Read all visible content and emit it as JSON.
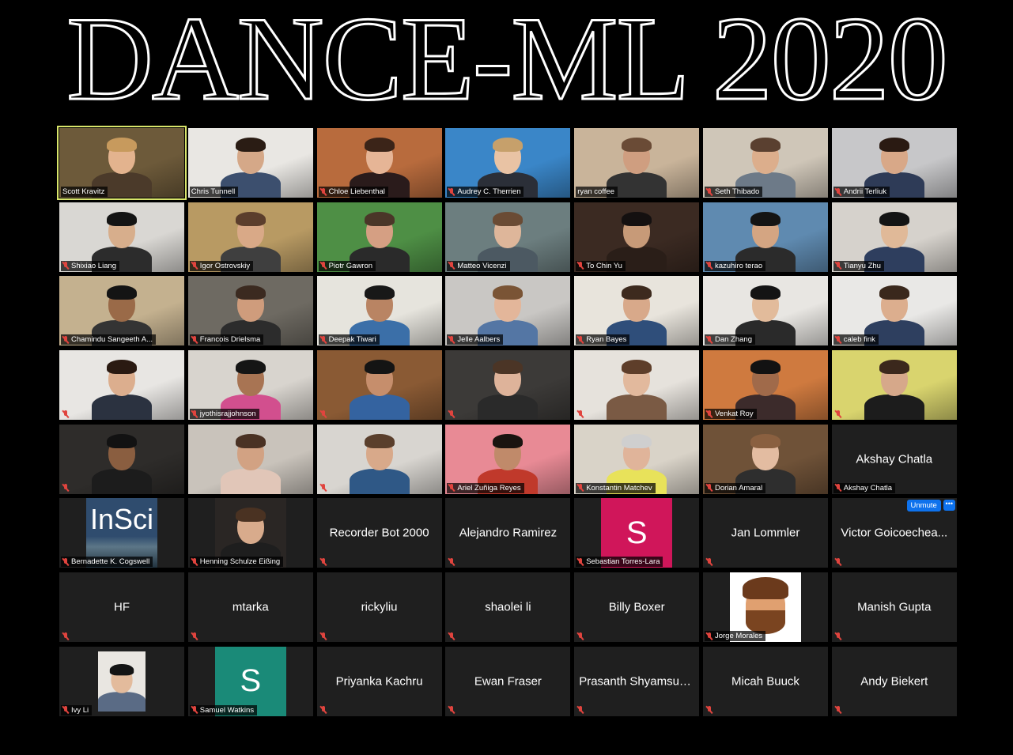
{
  "title": "DANCE-ML 2020",
  "controls": {
    "unmute_label": "Unmute",
    "more_label": "•••"
  },
  "tiles": [
    {
      "name": "Scott Kravitz",
      "type": "video",
      "bg": "#6d5a3a",
      "skin": "#e3b38e",
      "shirt": "#4b3a2a",
      "hair": "#c79a5d",
      "active": true,
      "muted": false
    },
    {
      "name": "Chris Tunnell",
      "type": "video",
      "bg": "#e9e7e3",
      "skin": "#d5a888",
      "shirt": "#3c4f6e",
      "hair": "#2a1c14",
      "muted": false
    },
    {
      "name": "Chloe Liebenthal",
      "type": "video",
      "bg": "#b86b3d",
      "skin": "#e6b596",
      "shirt": "#2a1b1b",
      "hair": "#3b2418",
      "muted": true
    },
    {
      "name": "Audrey C. Therrien",
      "type": "video",
      "bg": "#3a86c8",
      "skin": "#e9c3a4",
      "shirt": "#2b2f38",
      "hair": "#c6a06b",
      "muted": true
    },
    {
      "name": "ryan coffee",
      "type": "video",
      "bg": "#c9b49a",
      "skin": "#cf9e80",
      "shirt": "#333333",
      "hair": "#6a4b36",
      "muted": false
    },
    {
      "name": "Seth Thibado",
      "type": "video",
      "bg": "#cfc6b8",
      "skin": "#dcae8c",
      "shirt": "#6d7a88",
      "hair": "#5a4030",
      "muted": true
    },
    {
      "name": "Andrii Terliuk",
      "type": "video",
      "bg": "#c7c7c9",
      "skin": "#d8a888",
      "shirt": "#2e3b57",
      "hair": "#2a1a12",
      "muted": true
    },
    {
      "name": "Shixiao Liang",
      "type": "video",
      "bg": "#d9d7d3",
      "skin": "#d7ae8c",
      "shirt": "#2c2c2c",
      "hair": "#141414",
      "muted": true
    },
    {
      "name": "Igor Ostrovskiy",
      "type": "video",
      "bg": "#b89a63",
      "skin": "#d9a987",
      "shirt": "#3f3f3f",
      "hair": "#5b3e2c",
      "muted": true
    },
    {
      "name": "Piotr Gawron",
      "type": "video",
      "bg": "#4e8f45",
      "skin": "#d59f83",
      "shirt": "#2a2a2a",
      "hair": "#4a3628",
      "muted": true
    },
    {
      "name": "Matteo Vicenzi",
      "type": "video",
      "bg": "#6c7e7f",
      "skin": "#deb69a",
      "shirt": "#4c5962",
      "hair": "#6a4b34",
      "muted": true
    },
    {
      "name": "To Chin Yu",
      "type": "video",
      "bg": "#3b2a22",
      "skin": "#c79a78",
      "shirt": "#2a1e18",
      "hair": "#141010",
      "muted": true
    },
    {
      "name": "kazuhiro terao",
      "type": "video",
      "bg": "#5f8ab0",
      "skin": "#d4a582",
      "shirt": "#2b2b2b",
      "hair": "#141414",
      "muted": true
    },
    {
      "name": "Tianyu Zhu",
      "type": "video",
      "bg": "#d6d2cc",
      "skin": "#e0b998",
      "shirt": "#2e3e5e",
      "hair": "#141414",
      "muted": true
    },
    {
      "name": "Chamindu Sangeeth A...",
      "type": "video",
      "bg": "#c4b18f",
      "skin": "#9a6a48",
      "shirt": "#343434",
      "hair": "#141414",
      "muted": true
    },
    {
      "name": "Francois Drielsma",
      "type": "video",
      "bg": "#6e6a62",
      "skin": "#cf9c7c",
      "shirt": "#2c2c2c",
      "hair": "#3b2a20",
      "muted": true
    },
    {
      "name": "Deepak Tiwari",
      "type": "video",
      "bg": "#e6e4dd",
      "skin": "#b98463",
      "shirt": "#3b6fa8",
      "hair": "#181818",
      "muted": true
    },
    {
      "name": "Jelle Aalbers",
      "type": "video",
      "bg": "#c9c7c4",
      "skin": "#e3b69a",
      "shirt": "#5476a4",
      "hair": "#7a5435",
      "muted": true
    },
    {
      "name": "Ryan Bayes",
      "type": "video",
      "bg": "#e8e4dc",
      "skin": "#d8a98a",
      "shirt": "#2f4e7a",
      "hair": "#3d2a1e",
      "muted": true
    },
    {
      "name": "Dan Zhang",
      "type": "video",
      "bg": "#e8e6e2",
      "skin": "#e2bb9b",
      "shirt": "#2a2a2a",
      "hair": "#141414",
      "muted": true
    },
    {
      "name": "caleb fink",
      "type": "video",
      "bg": "#e9e8e6",
      "skin": "#dcae8e",
      "shirt": "#2e3f5f",
      "hair": "#3a281c",
      "muted": true
    },
    {
      "name": "",
      "type": "video",
      "bg": "#e8e6e3",
      "skin": "#dcae8e",
      "shirt": "#2b3240",
      "hair": "#2a1a12",
      "muted": true
    },
    {
      "name": "jyothisrajjohnson",
      "type": "video",
      "bg": "#d8d4ce",
      "skin": "#a87453",
      "shirt": "#d24f8e",
      "hair": "#151515",
      "muted": true
    },
    {
      "name": "",
      "type": "video",
      "bg": "#8a5a34",
      "skin": "#c68e6c",
      "shirt": "#3463a0",
      "hair": "#141414",
      "muted": true
    },
    {
      "name": "",
      "type": "video",
      "bg": "#3c3a38",
      "skin": "#deb39a",
      "shirt": "#2a2a2a",
      "hair": "#4b3526",
      "muted": true
    },
    {
      "name": "",
      "type": "video",
      "bg": "#e6e2dc",
      "skin": "#e2b99d",
      "shirt": "#7a5a44",
      "hair": "#5e3e2a",
      "muted": true
    },
    {
      "name": "Venkat Roy",
      "type": "video",
      "bg": "#cf7a3f",
      "skin": "#a06a4a",
      "shirt": "#3c2b2b",
      "hair": "#121212",
      "muted": true
    },
    {
      "name": "",
      "type": "video",
      "bg": "#d9d46e",
      "skin": "#d6a88a",
      "shirt": "#1c1c1c",
      "hair": "#3b281c",
      "muted": true
    },
    {
      "name": "",
      "type": "video",
      "bg": "#2e2c2a",
      "skin": "#8a5e40",
      "shirt": "#1c1c1c",
      "hair": "#121212",
      "muted": true
    },
    {
      "name": "",
      "type": "video",
      "bg": "#c9c3bb",
      "skin": "#d2a283",
      "shirt": "#e1c6b8",
      "hair": "#4a3224",
      "muted": false
    },
    {
      "name": "",
      "type": "video",
      "bg": "#d8d5d0",
      "skin": "#d8a98a",
      "shirt": "#2f5886",
      "hair": "#5a3f2c",
      "muted": true
    },
    {
      "name": "Ariel Zuñiga Reyes",
      "type": "video",
      "bg": "#e88a95",
      "skin": "#c08a6a",
      "shirt": "#c0392b",
      "hair": "#1a1410",
      "muted": true
    },
    {
      "name": "Konstantin Matchev",
      "type": "video",
      "bg": "#d9d3c8",
      "skin": "#e0b49a",
      "shirt": "#e8e25a",
      "hair": "#cfcfcf",
      "muted": true
    },
    {
      "name": "Dorian Amaral",
      "type": "video",
      "bg": "#6f5238",
      "skin": "#e3bca1",
      "shirt": "#2e2e2e",
      "hair": "#8a6040",
      "muted": true
    },
    {
      "name": "Akshay Chatla",
      "type": "name",
      "big": "Akshay Chatla",
      "muted": true
    },
    {
      "name": "Bernadette K. Cogswell",
      "type": "insci",
      "logo": "InSci",
      "muted": true
    },
    {
      "name": "Henning Schulze Eißing",
      "type": "photo",
      "bg": "#2a2624",
      "skin": "#d8ab8c",
      "shirt": "#1e1e1e",
      "hair": "#4a3222",
      "muted": true
    },
    {
      "name": "",
      "type": "name",
      "big": "Recorder Bot 2000",
      "muted": true
    },
    {
      "name": "",
      "type": "name",
      "big": "Alejandro Ramirez",
      "muted": true
    },
    {
      "name": "Sebastian Torres-Lara",
      "type": "letter",
      "letter": "S",
      "color": "#d0165a",
      "muted": true
    },
    {
      "name": "",
      "type": "name",
      "big": "Jan Lommler",
      "muted": true
    },
    {
      "name": "",
      "type": "name",
      "big": "Victor Goicoechea...",
      "muted": true,
      "unmute": true
    },
    {
      "name": "",
      "type": "name",
      "big": "HF",
      "muted": true
    },
    {
      "name": "",
      "type": "name",
      "big": "mtarka",
      "muted": true
    },
    {
      "name": "",
      "type": "name",
      "big": "rickyliu",
      "muted": true
    },
    {
      "name": "",
      "type": "name",
      "big": "shaolei li",
      "muted": true
    },
    {
      "name": "",
      "type": "name",
      "big": "Billy Boxer",
      "muted": true
    },
    {
      "name": "Jorge Morales",
      "type": "emoji",
      "muted": true
    },
    {
      "name": "",
      "type": "name",
      "big": "Manish Gupta",
      "muted": true
    },
    {
      "name": "Ivy Li",
      "type": "photo-small",
      "bg": "#e9e6e1",
      "skin": "#e3bb9c",
      "shirt": "#5a6b85",
      "hair": "#141414",
      "muted": true
    },
    {
      "name": "Samuel Watkins",
      "type": "letter",
      "letter": "S",
      "color": "#1a8a78",
      "muted": true
    },
    {
      "name": "",
      "type": "name",
      "big": "Priyanka Kachru",
      "muted": true
    },
    {
      "name": "",
      "type": "name",
      "big": "Ewan Fraser",
      "muted": true
    },
    {
      "name": "",
      "type": "name",
      "big": "Prasanth Shyamsun...",
      "muted": true
    },
    {
      "name": "",
      "type": "name",
      "big": "Micah Buuck",
      "muted": true
    },
    {
      "name": "",
      "type": "name",
      "big": "Andy Biekert",
      "muted": true
    }
  ]
}
